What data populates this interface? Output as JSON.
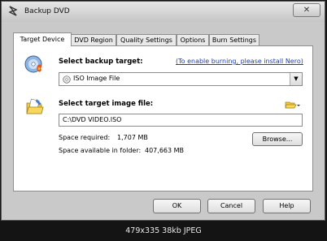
{
  "window": {
    "title": "Backup DVD",
    "close_label": "✕"
  },
  "tabs": [
    {
      "label": "Target Device",
      "active": true
    },
    {
      "label": "DVD Region"
    },
    {
      "label": "Quality Settings"
    },
    {
      "label": "Options"
    },
    {
      "label": "Burn Settings"
    }
  ],
  "target": {
    "label": "Select backup target:",
    "link": "(To enable burning, please install Nero)",
    "selected": "ISO Image File"
  },
  "image_file": {
    "label": "Select target image file:",
    "value": "C:\\DVD VIDEO.ISO",
    "browse_label": "Browse..."
  },
  "space": {
    "required_label": "Space required:",
    "required_value": "1,707 MB",
    "available_label": "Space available in folder:",
    "available_value": "407,663 MB"
  },
  "footer": {
    "ok": "OK",
    "cancel": "Cancel",
    "help": "Help"
  },
  "caption": "479x335 38kb JPEG"
}
